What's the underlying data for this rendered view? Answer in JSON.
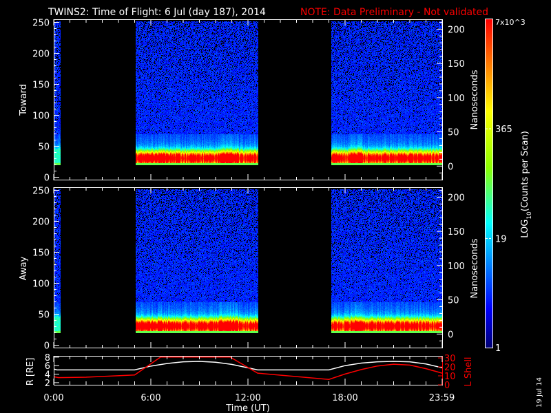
{
  "title": {
    "main": "TWINS2: Time of Flight:  6 Jul (day 187), 2014",
    "note": "NOTE: Data Preliminary - Not validated"
  },
  "footer_date": "19 Jul 14",
  "colors": {
    "background": "#000000",
    "axes": "#ffffff",
    "note": "#ff0000",
    "lshell": "#ff0000",
    "radius": "#ffffff"
  },
  "chart_data": [
    {
      "type": "heatmap",
      "name": "Toward",
      "ylabel": "Toward",
      "y2label": "Nanoseconds",
      "ylim": [
        -5,
        255
      ],
      "yticks": [
        0,
        50,
        100,
        150,
        200,
        250
      ],
      "y2ticks": [
        0,
        50,
        100,
        150,
        200
      ],
      "y2_zero_at_bin": 18,
      "y2_ns_per_bin": 0.905,
      "data_intervals_hours": [
        [
          0,
          0.42
        ],
        [
          5.05,
          12.62
        ],
        [
          17.12,
          24
        ]
      ],
      "band_center_bin": 32
    },
    {
      "type": "heatmap",
      "name": "Away",
      "ylabel": "Away",
      "y2label": "Nanoseconds",
      "ylim": [
        -5,
        255
      ],
      "yticks": [
        0,
        50,
        100,
        150,
        200,
        250
      ],
      "y2ticks": [
        0,
        50,
        100,
        150,
        200
      ],
      "y2_zero_at_bin": 18,
      "y2_ns_per_bin": 0.905,
      "data_intervals_hours": [
        [
          0,
          0.42
        ],
        [
          5.05,
          12.62
        ],
        [
          17.12,
          24
        ]
      ],
      "band_center_bin": 32
    },
    {
      "type": "line",
      "name": "Orbit",
      "ylabel": "R [RE]",
      "y2label": "L Shell",
      "xlabel": "Time (UT)",
      "xticks": [
        {
          "h": 0,
          "label": "0:00"
        },
        {
          "h": 6,
          "label": "6:00"
        },
        {
          "h": 12,
          "label": "12:00"
        },
        {
          "h": 18,
          "label": "18:00"
        },
        {
          "h": 23.98,
          "label": "23:59"
        }
      ],
      "ylim": [
        1.5,
        8.3
      ],
      "yticks": [
        2,
        4,
        6,
        8
      ],
      "y2lim": [
        0,
        30
      ],
      "y2ticks": [
        0,
        10,
        20,
        30
      ],
      "series": [
        {
          "name": "R",
          "axis": "left",
          "x": [
            0,
            0.2,
            5,
            6,
            7,
            8,
            9,
            10,
            11,
            12.6,
            17,
            18,
            19,
            20,
            21,
            22,
            23,
            24
          ],
          "values": [
            5.2,
            5,
            5,
            5.9,
            6.5,
            6.9,
            7,
            6.8,
            6.3,
            5,
            5,
            6,
            6.6,
            6.9,
            7,
            6.9,
            6.4,
            5.5
          ]
        },
        {
          "name": "L Shell",
          "axis": "right",
          "x": [
            0,
            0.3,
            2,
            5,
            6.6,
            10.9,
            12.6,
            17,
            18,
            19,
            20,
            21,
            22,
            23,
            24
          ],
          "values": [
            9,
            8,
            8.5,
            11,
            31,
            31,
            13,
            6,
            12,
            17,
            21,
            23,
            22,
            18,
            13
          ]
        }
      ]
    }
  ],
  "colorbar": {
    "label": "LOG10(Counts per Scan)",
    "label_main": "LOG",
    "label_sub": "10",
    "label_rest": "(Counts per Scan)",
    "ticks": [
      {
        "v": 1,
        "label": "1"
      },
      {
        "v": 19,
        "label": "19"
      },
      {
        "v": 365,
        "label": "365"
      },
      {
        "v": 7000,
        "label": "7x10^3",
        "base": "7x10",
        "exp": "3"
      }
    ],
    "range": [
      1,
      7000
    ]
  }
}
